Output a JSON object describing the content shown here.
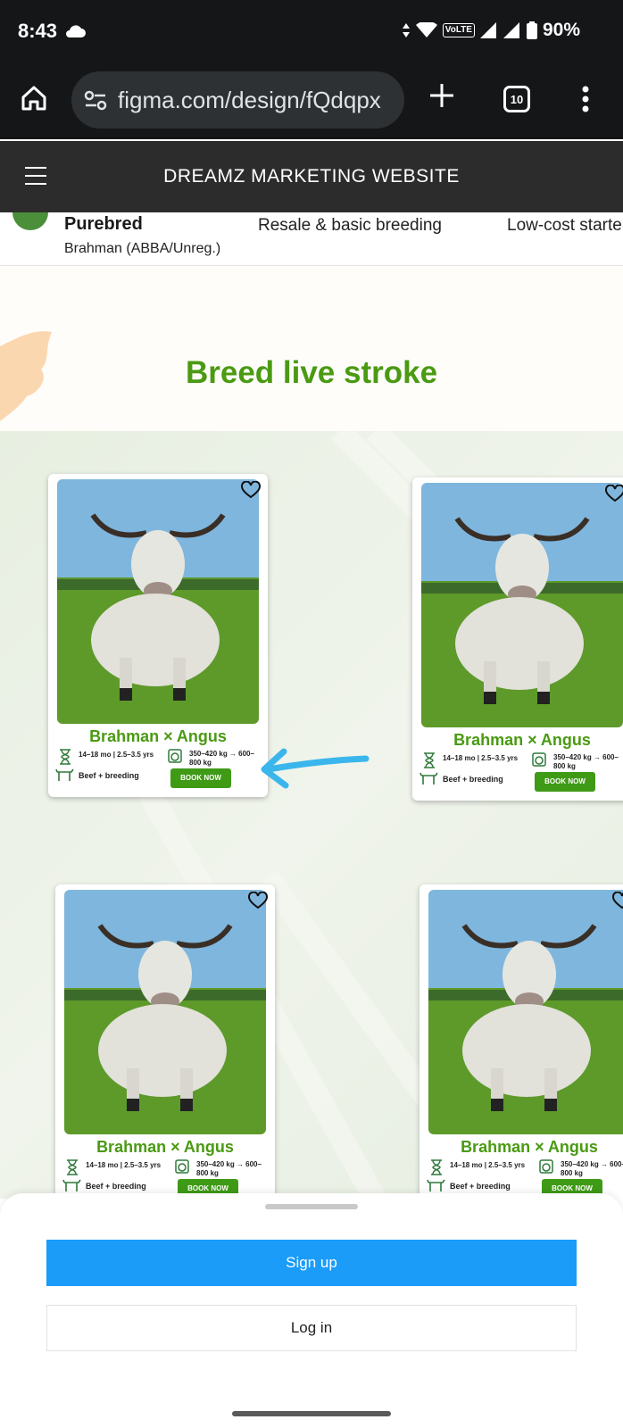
{
  "status_bar": {
    "time": "8:43",
    "network": "VoLTE",
    "battery": "90%"
  },
  "browser": {
    "url": "figma.com/design/fQdqpx",
    "tab_count": "10"
  },
  "site": {
    "title": "DREAMZ MARKETING WEBSITE"
  },
  "table_row": {
    "breed": "Purebred",
    "breed_sub": "Brahman (ABBA/Unreg.)",
    "use": "Resale & basic breeding",
    "cost": "Low-cost starte"
  },
  "section": {
    "title": "Breed live stroke"
  },
  "cards": [
    {
      "name": "Brahman × Angus",
      "age": "14–18 mo | 2.5–3.5 yrs",
      "weight": "350–420 kg → 600–800 kg",
      "use": "Beef + breeding",
      "cta": "BOOK NOW"
    },
    {
      "name": "Brahman × Angus",
      "age": "14–18 mo | 2.5–3.5 yrs",
      "weight": "350–420 kg → 600–800 kg",
      "use": "Beef + breeding",
      "cta": "BOOK NOW"
    },
    {
      "name": "Brahman × Angus",
      "age": "14–18 mo | 2.5–3.5 yrs",
      "weight": "350–420 kg → 600–800 kg",
      "use": "Beef + breeding",
      "cta": "BOOK NOW"
    },
    {
      "name": "Brahman × Angus",
      "age": "14–18 mo | 2.5–3.5 yrs",
      "weight": "350–420 kg → 600–800 kg",
      "use": "Beef + breeding",
      "cta": "BOOK NOW"
    }
  ],
  "sheet": {
    "signup": "Sign up",
    "login": "Log in"
  },
  "colors": {
    "brand_green": "#4a9a12",
    "signup_blue": "#1a9cf8",
    "annotation_arrow": "#3bb6ec"
  }
}
